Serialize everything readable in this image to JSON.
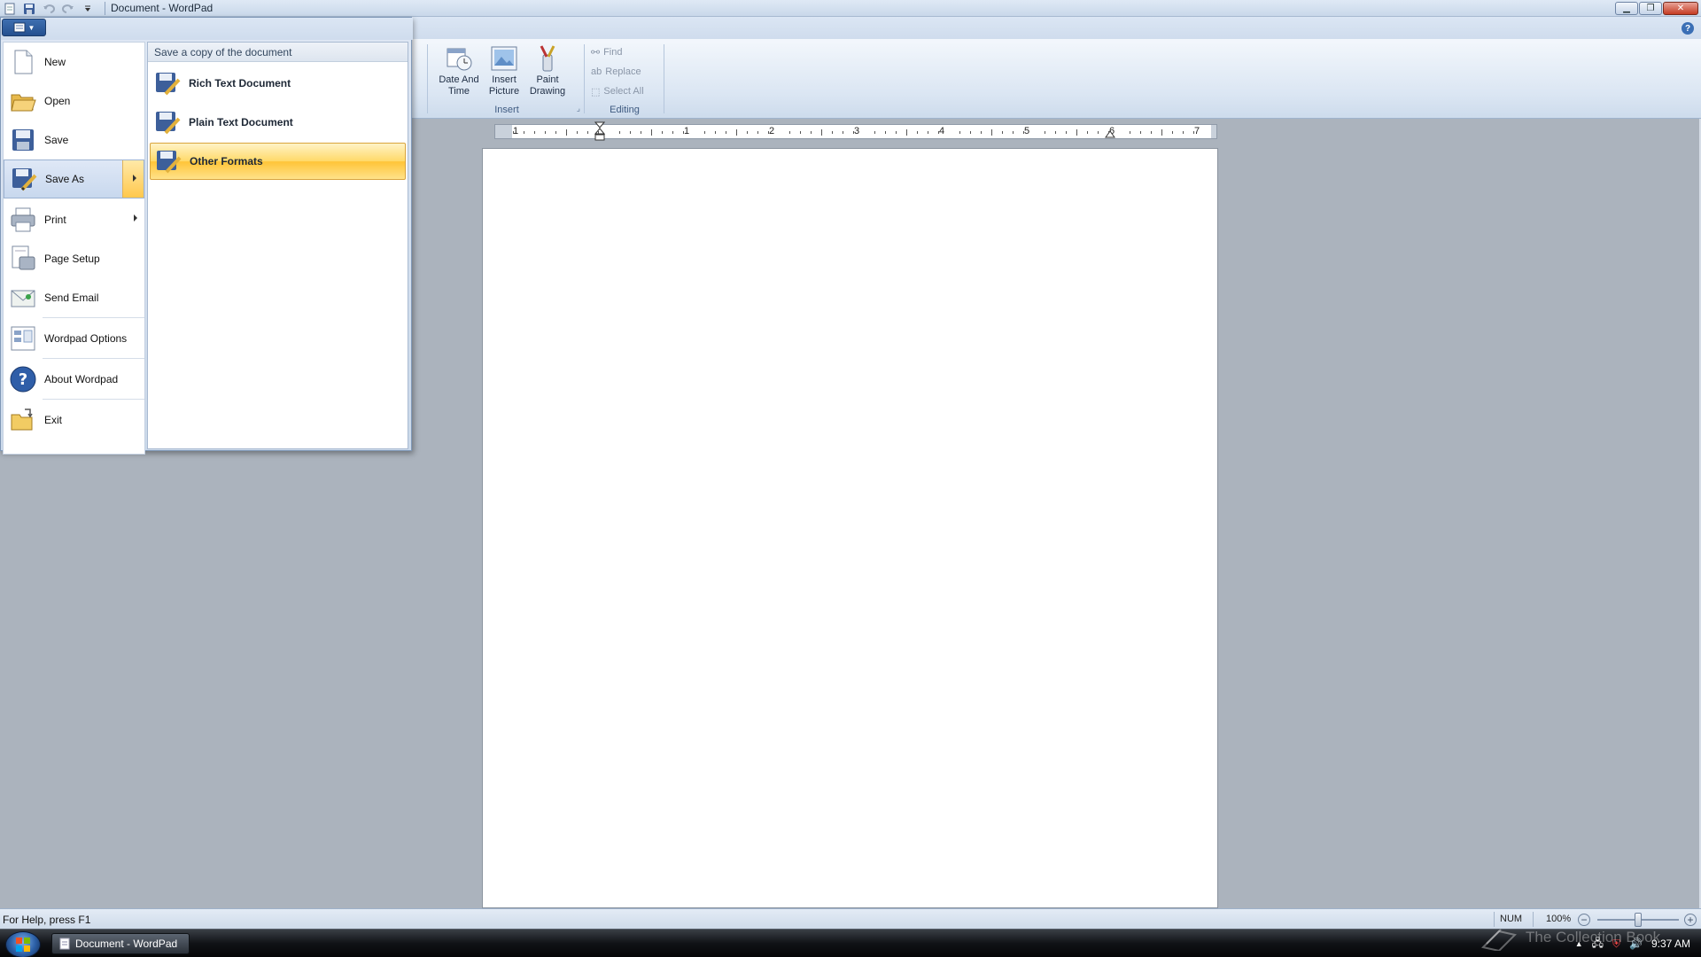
{
  "window": {
    "title": "Document - WordPad"
  },
  "ribbon": {
    "insert": {
      "label": "Insert",
      "date_time": "Date And Time",
      "insert_picture": "Insert Picture",
      "paint_drawing": "Paint Drawing"
    },
    "editing": {
      "label": "Editing",
      "find": "Find",
      "replace": "Replace",
      "select_all": "Select All"
    }
  },
  "ruler": {
    "numbers": [
      "1",
      "1",
      "2",
      "3",
      "4",
      "5",
      "6",
      "7"
    ]
  },
  "app_menu": {
    "items": [
      {
        "label": "New",
        "icon": "new-document-icon"
      },
      {
        "label": "Open",
        "icon": "open-folder-icon"
      },
      {
        "label": "Save",
        "icon": "save-disk-icon"
      },
      {
        "label": "Save As",
        "icon": "save-as-icon"
      },
      {
        "label": "Print",
        "icon": "printer-icon"
      },
      {
        "label": "Page Setup",
        "icon": "page-setup-icon"
      },
      {
        "label": "Send Email",
        "icon": "email-icon"
      },
      {
        "label": "Wordpad Options",
        "icon": "options-icon"
      },
      {
        "label": "About Wordpad",
        "icon": "help-icon"
      },
      {
        "label": "Exit",
        "icon": "exit-icon"
      }
    ],
    "submenu": {
      "title": "Save a copy of the document",
      "items": [
        {
          "label": "Rich Text Document"
        },
        {
          "label": "Plain Text Document"
        },
        {
          "label": "Other Formats"
        }
      ]
    }
  },
  "status": {
    "help": "For Help, press F1",
    "num": "NUM",
    "zoom": "100%",
    "zoom_fraction": 0.5
  },
  "taskbar": {
    "task": "Document - WordPad",
    "clock": "9:37 AM",
    "watermark": "The Collection Book"
  },
  "colors": {
    "accent": "#2b5fa6",
    "hover": "#ffd968"
  }
}
